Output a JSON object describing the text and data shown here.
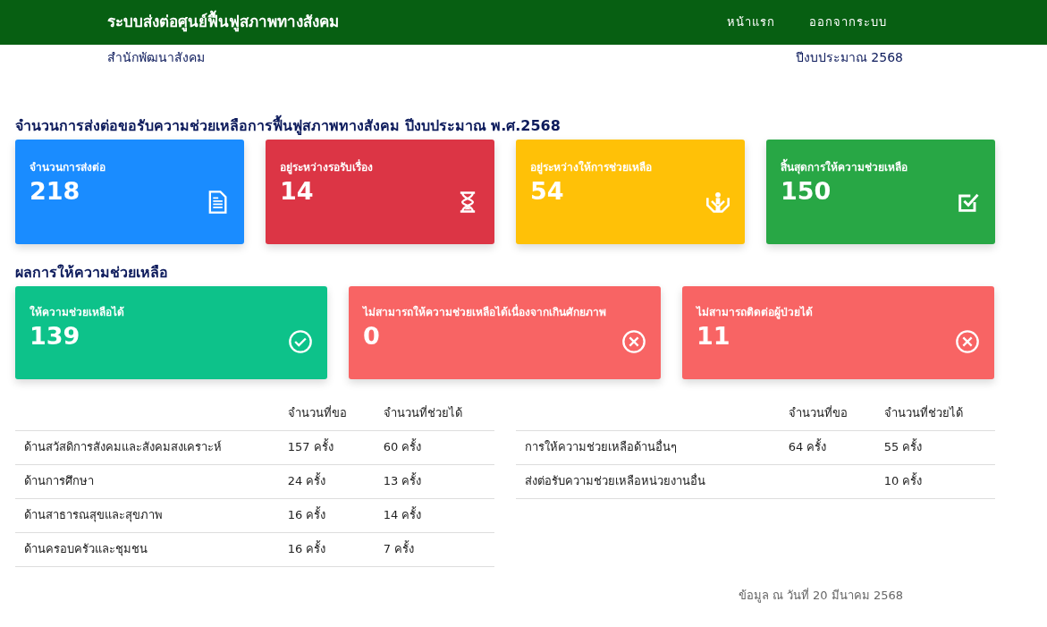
{
  "navbar": {
    "brand": "ระบบส่งต่อศูนย์ฟื้นฟูสภาพทางสังคม",
    "links": [
      "หน้าแรก",
      "ออกจากระบบ"
    ]
  },
  "subheader": {
    "office": "สำนักพัฒนาสังคม",
    "fiscal_year": "ปีงบประมาณ 2568"
  },
  "referral_section": {
    "title": "จำนวนการส่งต่อขอรับความช่วยเหลือการฟื้นฟูสภาพทางสังคม ปีงบประมาณ พ.ศ.2568",
    "cards": [
      {
        "label": "จำนวนการส่งต่อ",
        "value": "218",
        "kind": "total",
        "color": "#1a8cff"
      },
      {
        "label": "อยู่ระหว่างรอรับเรื่อง",
        "value": "14",
        "kind": "pending",
        "color": "#dc3545"
      },
      {
        "label": "อยู่ระหว่างให้การช่วยเหลือ",
        "value": "54",
        "kind": "assisting",
        "color": "#ffc107"
      },
      {
        "label": "สิ้นสุดการให้ความช่วยเหลือ",
        "value": "150",
        "kind": "done",
        "color": "#28a745"
      }
    ]
  },
  "result_section": {
    "title": "ผลการให้ความช่วยเหลือ",
    "cards": [
      {
        "label": "ให้ความช่วยเหลือได้",
        "value": "139",
        "kind": "success",
        "color": "#0dc28a"
      },
      {
        "label": "ไม่สามารถให้ความช่วยเหลือได้เนื่องจากเกินศักยภาพ",
        "value": "0",
        "kind": "failed",
        "color": "#f86464"
      },
      {
        "label": "ไม่สามารถติดต่อผู้ป่วยได้",
        "value": "11",
        "kind": "failed",
        "color": "#f86464"
      }
    ]
  },
  "tables": [
    {
      "columns": [
        "",
        "จำนวนที่ขอ",
        "จำนวนที่ช่วยได้"
      ],
      "rows": [
        [
          "ด้านสวัสดิการสังคมและสังคมสงเคราะห์",
          "157 ครั้ง",
          "60 ครั้ง"
        ],
        [
          "ด้านการศึกษา",
          "24 ครั้ง",
          "13 ครั้ง"
        ],
        [
          "ด้านสาธารณสุขและสุขภาพ",
          "16 ครั้ง",
          "14 ครั้ง"
        ],
        [
          "ด้านครอบครัวและชุมชน",
          "16 ครั้ง",
          "7 ครั้ง"
        ]
      ]
    },
    {
      "columns": [
        "",
        "จำนวนที่ขอ",
        "จำนวนที่ช่วยได้"
      ],
      "rows": [
        [
          "การให้ความช่วยเหลือด้านอื่นๆ",
          "64 ครั้ง",
          "55 ครั้ง"
        ],
        [
          "ส่งต่อรับความช่วยเหลือหน่วยงานอื่น",
          "",
          "10 ครั้ง"
        ]
      ]
    }
  ],
  "footer": {
    "note": "ข้อมูล ณ วันที่ 20 มีนาคม 2568"
  }
}
